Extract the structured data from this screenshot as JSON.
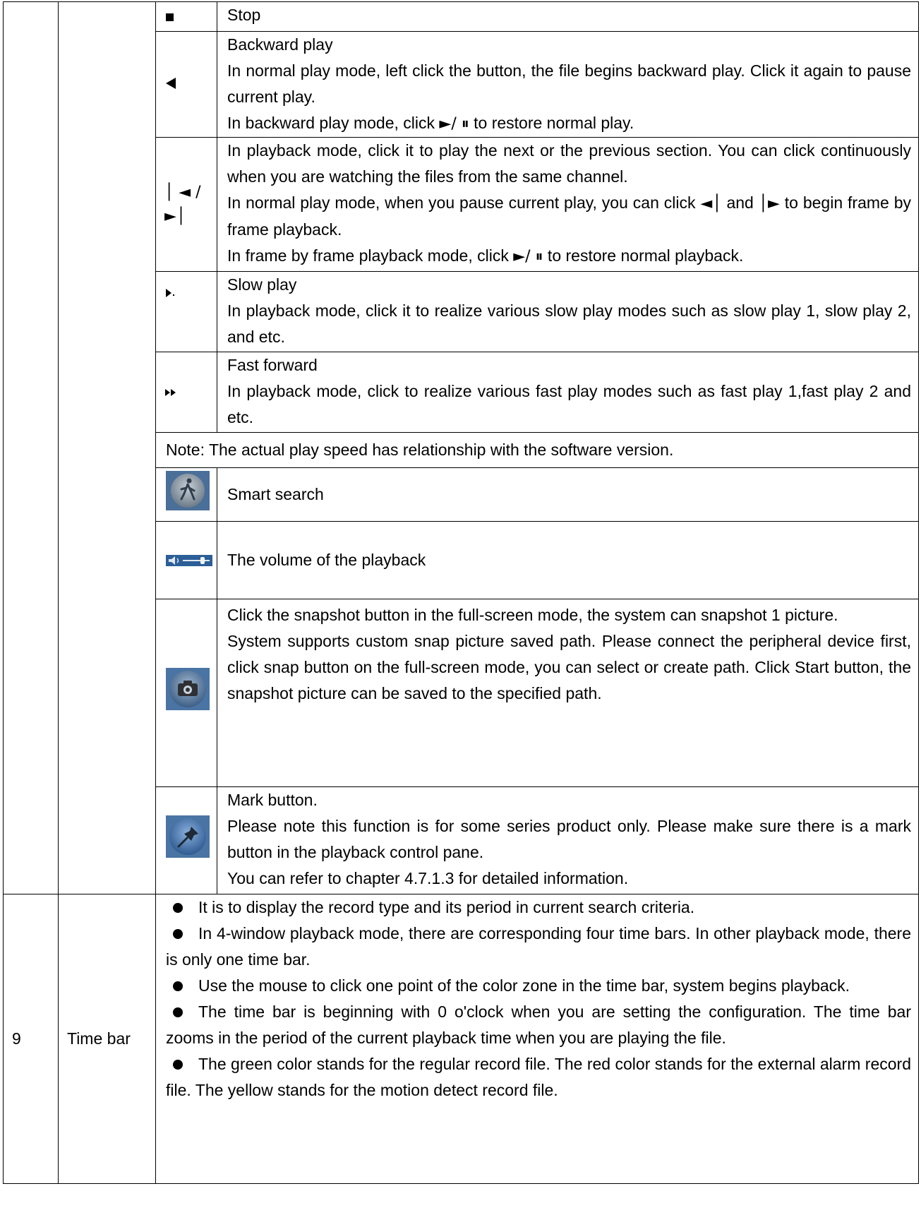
{
  "rows": {
    "stop": {
      "icon": "stop-icon",
      "desc": "Stop"
    },
    "backward": {
      "icon": "backward-play-icon",
      "title": "Backward play",
      "line1": "In normal play mode, left click the button, the file begins backward play. Click it again to pause current play.",
      "line2a": "In backward play mode, click ",
      "line2sym": "►/ ⏸",
      "line2b": " to restore normal play."
    },
    "section": {
      "icon": "prev-next-section-icon",
      "icon_text_top": "│ ◄ /",
      "icon_text_bottom": "►│",
      "line1": "In playback mode, click it to play the next or the previous section. You can click continuously when you are watching the files from the same channel.",
      "line2a": "In normal play mode, when you pause current play, you can click ",
      "line2sym1": "◄│",
      "line2b": " and ",
      "line2sym2": "│►",
      "line2c": " to begin frame by frame playback.",
      "line3a": "In frame by frame playback mode, click ",
      "line3sym": "►/ ⏸",
      "line3b": " to restore normal playback."
    },
    "slow": {
      "icon": "slow-play-icon",
      "title": "Slow play",
      "line1": "In playback mode, click it to realize various slow play modes such as slow play 1, slow play 2, and etc."
    },
    "fast": {
      "icon": "fast-forward-icon",
      "title": "Fast forward",
      "line1": "In playback mode, click to realize various fast play modes such as  fast play 1,fast play 2 and etc."
    },
    "note": "Note: The actual play speed has relationship with the software version.",
    "smart": {
      "icon": "smart-search-icon",
      "desc": "Smart search"
    },
    "volume": {
      "icon": "volume-slider-icon",
      "desc": "The volume of the playback"
    },
    "snapshot": {
      "icon": "camera-icon",
      "line1": "Click the snapshot button in the full-screen mode, the system can snapshot 1 picture.",
      "line2": "System supports custom snap picture saved path. Please connect the peripheral device first, click snap button on the full-screen mode, you can select or create path. Click Start button, the snapshot picture can be saved to the specified path."
    },
    "mark": {
      "icon": "pin-icon",
      "title": "Mark button.",
      "line1": "Please note this function is for some series product only. Please make sure there is a mark button in the playback control pane.",
      "line2": "You can refer to chapter 4.7.1.3 for detailed information."
    },
    "timebar": {
      "num": "9",
      "name": "Time bar",
      "b1": "It is to display the record type and its period in current search criteria.",
      "b2": "In 4-window playback mode, there are corresponding four time bars. In other playback mode, there is only one time bar.",
      "b3": "Use the mouse to click one point of the color zone in the time bar, system begins playback.",
      "b4": "The time bar is beginning with 0 o'clock when you are setting the configuration. The time bar zooms in the period of the current playback time when you are playing the file.",
      "b5": "The green color stands for the regular record file. The red color stands for the external alarm record file. The yellow stands for the motion detect record file."
    }
  }
}
